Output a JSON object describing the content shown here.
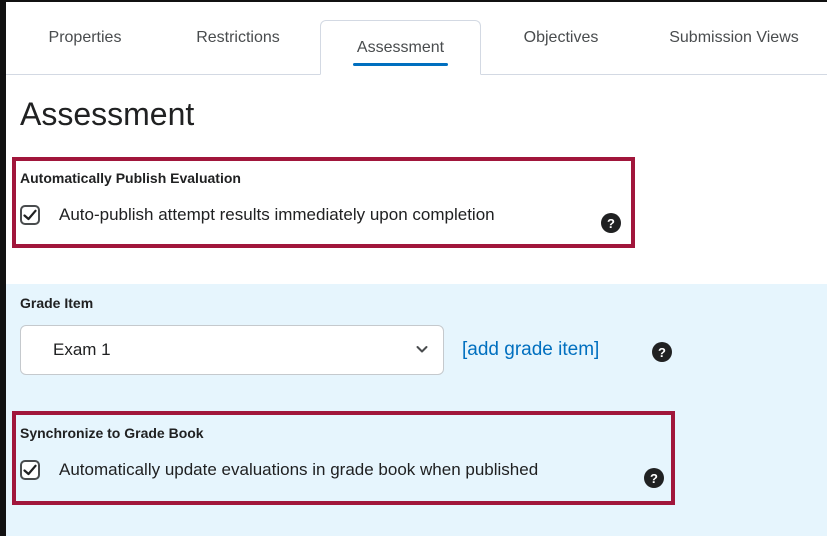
{
  "tabs": [
    {
      "label": "Properties"
    },
    {
      "label": "Restrictions"
    },
    {
      "label": "Assessment",
      "active": true
    },
    {
      "label": "Objectives"
    },
    {
      "label": "Submission Views"
    }
  ],
  "page": {
    "title": "Assessment"
  },
  "auto_publish": {
    "heading": "Automatically Publish Evaluation",
    "checkbox_label": "Auto-publish attempt results immediately upon completion",
    "checked": true,
    "help_icon": "question-circle-icon"
  },
  "grade_item": {
    "heading": "Grade Item",
    "selected": "Exam 1",
    "add_link": "[add grade item]",
    "help_icon": "question-circle-icon"
  },
  "sync": {
    "heading": "Synchronize to Grade Book",
    "checkbox_label": "Automatically update evaluations in grade book when published",
    "checked": true,
    "help_icon": "question-circle-icon"
  },
  "colors": {
    "accent": "#006fbf",
    "highlight": "#a1163b",
    "panel": "#e6f5fd"
  }
}
